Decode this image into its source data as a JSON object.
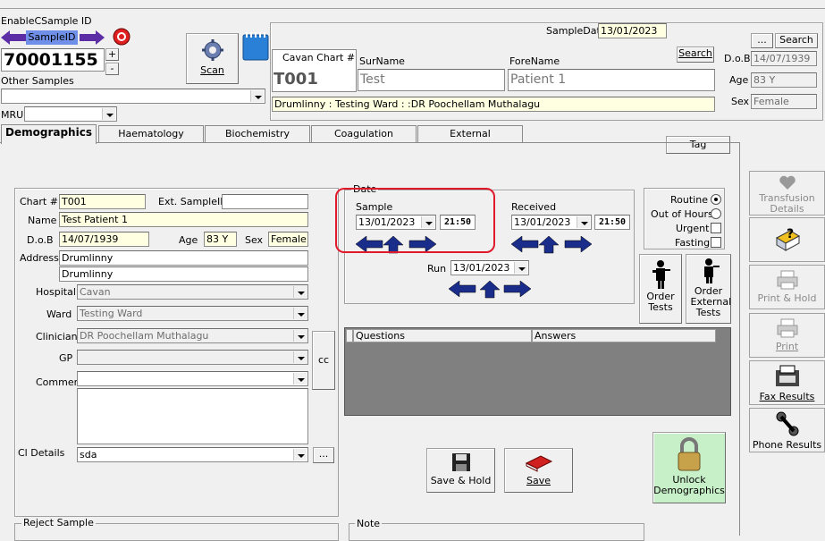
{
  "top": {
    "enable_label": "EnableCSample ID",
    "sample_id_label": "SampleID",
    "sample_id_value": "70001155",
    "plus": "+",
    "minus": "-",
    "other_samples_label": "Other Samples",
    "mru_label": "MRU",
    "scan_label": "Scan",
    "sample_date_label": "SampleDate",
    "sample_date_value": "13/01/2023",
    "dots_button": "...",
    "search_button": "Search",
    "search_button2": "Search",
    "cavan_chart_label": "Cavan Chart #",
    "chart_value": "T001",
    "surname_label": "SurName",
    "surname_value": "Test",
    "forename_label": "ForeName",
    "forename_value": "Patient 1",
    "dob_label": "D.o.B",
    "dob_value": "14/07/1939",
    "age_label": "Age",
    "age_value": "83 Y",
    "sex_label": "Sex",
    "sex_value": "Female",
    "location_text": "Drumlinny : Testing Ward : :DR Poochellam Muthalagu"
  },
  "tabs": [
    "Demographics",
    "Haematology",
    "Biochemistry",
    "Coagulation",
    "External"
  ],
  "tag_button": "Tag",
  "demo": {
    "chart_label": "Chart #",
    "chart_value": "T001",
    "ext_sample_label": "Ext. SampleID",
    "ext_sample_value": "",
    "name_label": "Name",
    "name_value": "Test Patient 1",
    "dob_label": "D.o.B",
    "dob_value": "14/07/1939",
    "age_label": "Age",
    "age_value": "83 Y",
    "sex_label": "Sex",
    "sex_value": "Female",
    "address_label": "Address",
    "address1": "Drumlinny",
    "address2": "Drumlinny",
    "hospital_label": "Hospital",
    "hospital_value": "Cavan",
    "ward_label": "Ward",
    "ward_value": "Testing Ward",
    "clinician_label": "Clinician",
    "clinician_value": "DR Poochellam Muthalagu",
    "gp_label": "GP",
    "gp_value": "",
    "comment_label": "Comment",
    "cc_button": "cc",
    "cl_label": "Cl Details",
    "cl_value": "sda",
    "cl_dots": "..."
  },
  "date": {
    "group_label": "Date",
    "sample_label": "Sample",
    "sample_date": "13/01/2023",
    "sample_time": "21:50",
    "received_label": "Received",
    "received_date": "13/01/2023",
    "received_time": "21:50",
    "run_label": "Run",
    "run_date": "13/01/2023"
  },
  "priority": {
    "routine": "Routine",
    "out_of_hours": "Out of Hours",
    "urgent": "Urgent",
    "fasting": "Fasting"
  },
  "order_tests": "Order Tests",
  "order_external": "Order External Tests",
  "grid": {
    "col1": "Questions",
    "col2": "Answers"
  },
  "save_hold": "Save & Hold",
  "save": "Save",
  "unlock": "Unlock Demographics",
  "reject_label": "Reject Sample",
  "note_label": "Note",
  "side": {
    "transfusion": "Transfusion Details",
    "print_hold": "Print & Hold",
    "print": "Print",
    "fax": "Fax Results",
    "phone": "Phone Results"
  },
  "colors": {
    "highlight_red": "#e01a2b",
    "field_yellow": "#ffffe1",
    "blue_arrow": "#1a2d8a"
  }
}
